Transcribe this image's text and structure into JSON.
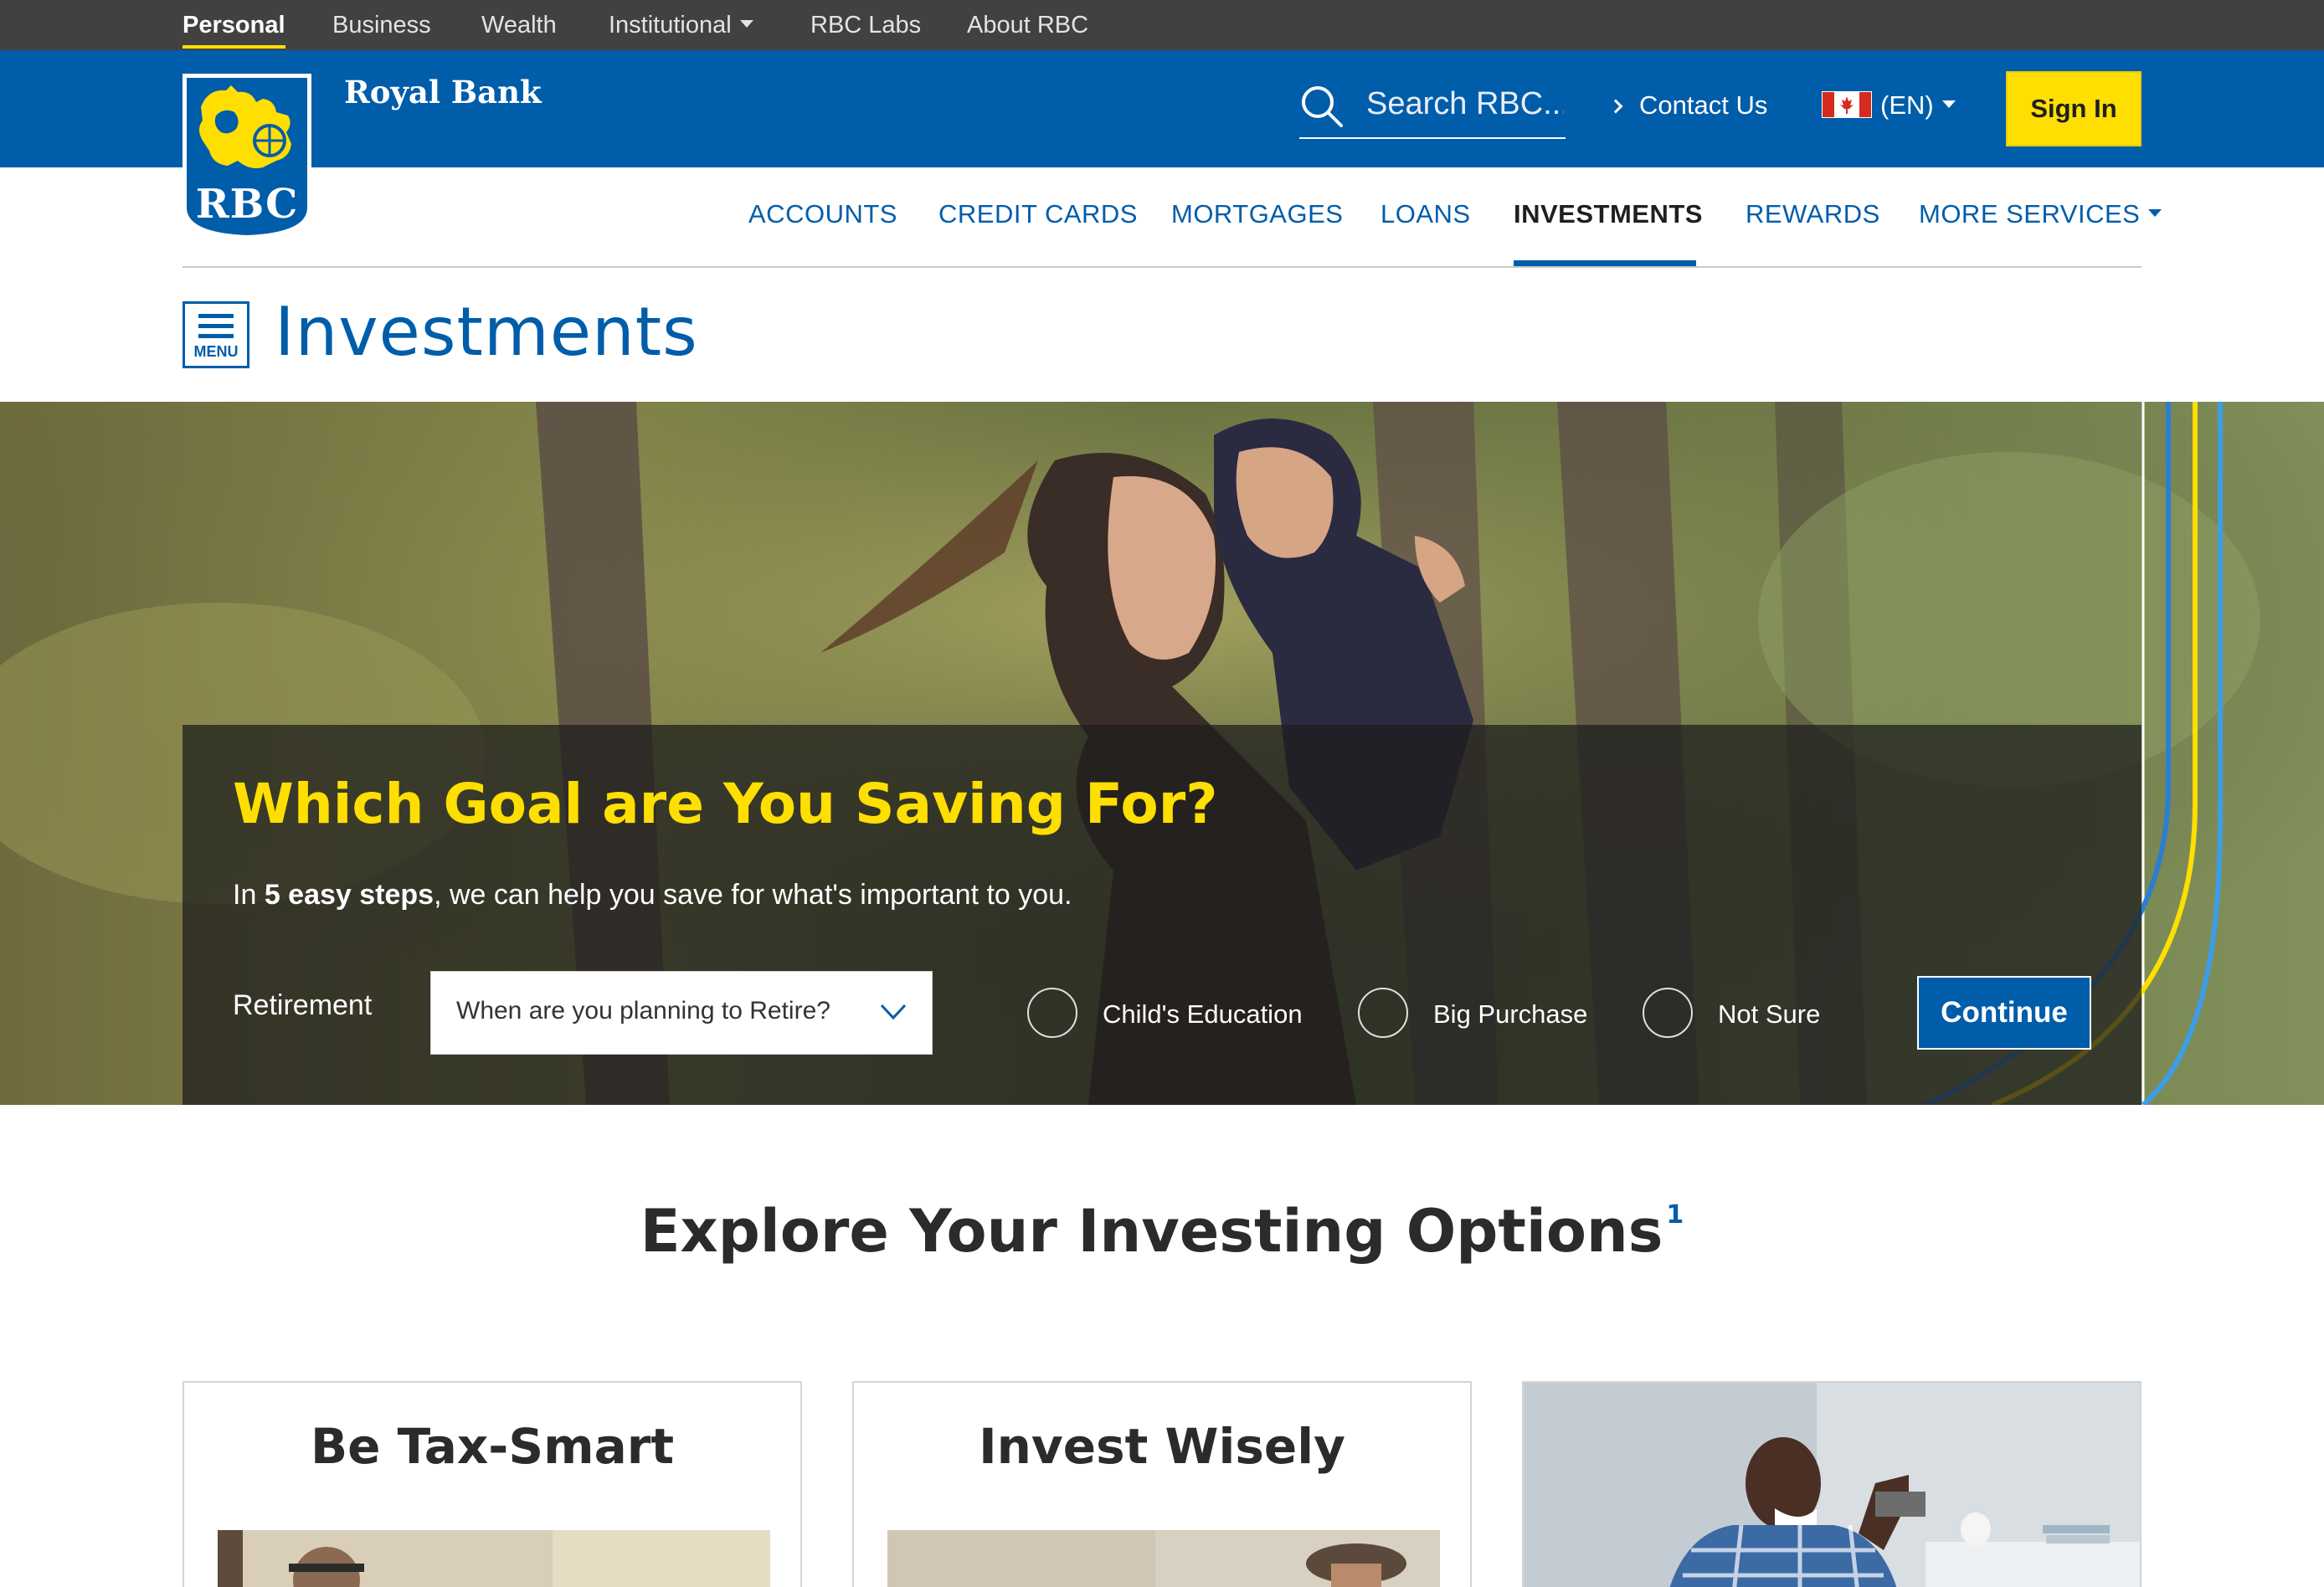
{
  "utility_nav": {
    "items": [
      {
        "label": "Personal"
      },
      {
        "label": "Business"
      },
      {
        "label": "Wealth"
      },
      {
        "label": "Institutional"
      },
      {
        "label": "RBC Labs"
      },
      {
        "label": "About RBC"
      }
    ]
  },
  "header": {
    "logo_text": "RBC",
    "bank_name": "Royal Bank",
    "search_placeholder": "Search RBC...",
    "contact_label": "Contact Us",
    "language_label": "(EN)",
    "signin_label": "Sign In"
  },
  "main_nav": {
    "items": [
      {
        "label": "ACCOUNTS"
      },
      {
        "label": "CREDIT CARDS"
      },
      {
        "label": "MORTGAGES"
      },
      {
        "label": "LOANS"
      },
      {
        "label": "INVESTMENTS"
      },
      {
        "label": "REWARDS"
      },
      {
        "label": "MORE SERVICES"
      }
    ],
    "active": "INVESTMENTS"
  },
  "page": {
    "menu_label": "MENU",
    "title": "Investments"
  },
  "goal_panel": {
    "title": "Which Goal are You Saving For?",
    "subtitle_prefix": "In ",
    "subtitle_bold": "5 easy steps",
    "subtitle_suffix": ", we can help you save for what's important to you.",
    "retirement_label": "Retirement",
    "retirement_select": "When are you planning to Retire?",
    "options": [
      {
        "label": "Child's Education"
      },
      {
        "label": "Big Purchase"
      },
      {
        "label": "Not Sure"
      }
    ],
    "continue_label": "Continue"
  },
  "explore": {
    "title": "Explore Your Investing Options",
    "footnote": "1"
  },
  "cards": [
    {
      "title": "Be Tax-Smart"
    },
    {
      "title": "Invest Wisely"
    }
  ],
  "colors": {
    "brand_blue": "#005daa",
    "brand_yellow": "#fedf01",
    "utility_bg": "#414141"
  }
}
